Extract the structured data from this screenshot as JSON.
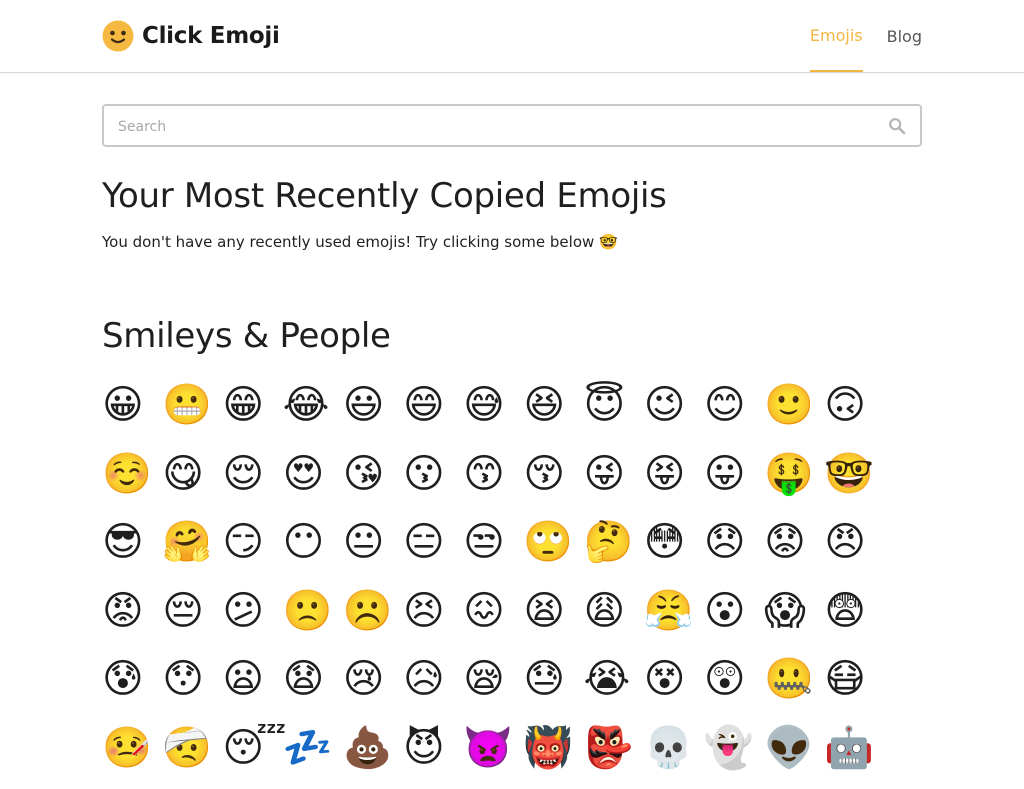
{
  "app": {
    "brand_name": "Click Emoji",
    "logo_icon": "smiley-face-logo",
    "accent_color": "#f0b640"
  },
  "nav": {
    "items": [
      {
        "label": "Emojis",
        "active": true
      },
      {
        "label": "Blog",
        "active": false
      }
    ]
  },
  "search": {
    "placeholder": "Search",
    "value": "",
    "icon": "search-icon"
  },
  "recent": {
    "heading": "Your Most Recently Copied Emojis",
    "empty_message": "You don't have any recently used emojis! Try clicking some below 🤓"
  },
  "section": {
    "heading": "Smileys & People",
    "emojis": [
      "😀",
      "😬",
      "😁",
      "😂",
      "😃",
      "😄",
      "😅",
      "😆",
      "😇",
      "😉",
      "😊",
      "🙂",
      "🙃",
      "☺️",
      "😋",
      "😌",
      "😍",
      "😘",
      "😗",
      "😙",
      "😚",
      "😜",
      "😝",
      "😛",
      "🤑",
      "🤓",
      "😎",
      "🤗",
      "😏",
      "😶",
      "😐",
      "😑",
      "😒",
      "🙄",
      "🤔",
      "😳",
      "😞",
      "😟",
      "😠",
      "😡",
      "😔",
      "😕",
      "🙁",
      "☹️",
      "😣",
      "😖",
      "😫",
      "😩",
      "😤",
      "😮",
      "😱",
      "😨",
      "😰",
      "😯",
      "😦",
      "😧",
      "😢",
      "😥",
      "😪",
      "😓",
      "😭",
      "😵",
      "😲",
      "🤐",
      "😷",
      "🤒",
      "🤕",
      "😴",
      "💤",
      "💩",
      "😈",
      "👿",
      "👹",
      "👺",
      "💀",
      "👻",
      "👽",
      "🤖"
    ]
  }
}
